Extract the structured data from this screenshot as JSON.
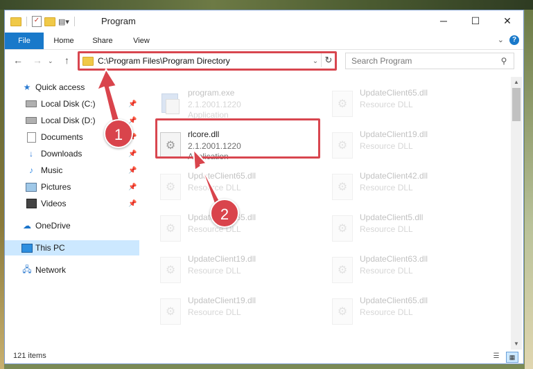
{
  "window": {
    "title": "Program",
    "controls": {
      "minimize": "─",
      "maximize": "☐",
      "close": "✕"
    }
  },
  "ribbon": {
    "tabs": [
      "File",
      "Home",
      "Share",
      "View"
    ],
    "help": "?"
  },
  "address_bar": {
    "path": "C:\\Program Files\\Program Directory"
  },
  "search": {
    "placeholder": "Search Program"
  },
  "sidebar": {
    "quick_access": "Quick access",
    "pinned": [
      "Local Disk (C:)",
      "Local Disk (D:)",
      "Documents",
      "Downloads",
      "Music",
      "Pictures",
      "Videos"
    ],
    "onedrive": "OneDrive",
    "this_pc": "This PC",
    "network": "Network"
  },
  "files": [
    {
      "name": "program.exe",
      "version": "2.1.2001.1220",
      "type": "Application",
      "icon": "exe-icon",
      "faded": true
    },
    {
      "name": "UpdateClient65.dll",
      "version": "Resource DLL",
      "type": "",
      "icon": "dll-icon",
      "faded": true
    },
    {
      "name": "rlcore.dll",
      "version": "2.1.2001.1220",
      "type": "Application",
      "icon": "dll-icon",
      "faded": false,
      "highlighted": true
    },
    {
      "name": "UpdateClient19.dll",
      "version": "Resource DLL",
      "type": "",
      "icon": "dll-icon",
      "faded": true
    },
    {
      "name": "UpdateClient65.dll",
      "version": "Resource DLL",
      "type": "",
      "icon": "dll-icon",
      "faded": true
    },
    {
      "name": "UpdateClient42.dll",
      "version": "Resource DLL",
      "type": "",
      "icon": "dll-icon",
      "faded": true
    },
    {
      "name": "UpdateClient65.dll",
      "version": "Resource DLL",
      "type": "",
      "icon": "dll-icon",
      "faded": true
    },
    {
      "name": "UpdateClient5.dll",
      "version": "Resource DLL",
      "type": "",
      "icon": "dll-icon",
      "faded": true
    },
    {
      "name": "UpdateClient19.dll",
      "version": "Resource DLL",
      "type": "",
      "icon": "dll-icon",
      "faded": true
    },
    {
      "name": "UpdateClient63.dll",
      "version": "Resource DLL",
      "type": "",
      "icon": "dll-icon",
      "faded": true
    },
    {
      "name": "UpdateClient19.dll",
      "version": "Resource DLL",
      "type": "",
      "icon": "dll-icon",
      "faded": true
    },
    {
      "name": "UpdateClient65.dll",
      "version": "Resource DLL",
      "type": "",
      "icon": "dll-icon",
      "faded": true
    }
  ],
  "status": {
    "item_count": "121 items"
  },
  "annotations": {
    "step1": "1",
    "step2": "2",
    "color": "#d9444c"
  }
}
